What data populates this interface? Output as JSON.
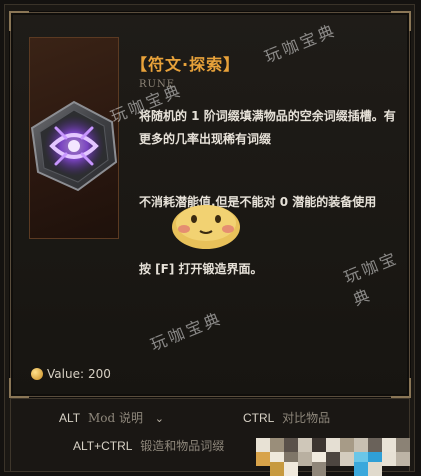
{
  "item": {
    "title": "【符文·探索】",
    "subtitle": "RUNE",
    "description_1": "将随机的 1 阶词缀填满物品的空余词缀插槽。有更多的几率出现稀有词缀",
    "description_2": "不消耗潜能值.但是不能对 0 潜能的装备使用",
    "description_3": "按 [F] 打开锻造界面。",
    "value_label": "Value:",
    "value": "200",
    "icon": "rune-purple-glyph-icon"
  },
  "hints": {
    "alt_key": "ALT",
    "alt_label": "Mod 说明",
    "ctrl_key": "CTRL",
    "ctrl_label": "对比物品",
    "altctrl_key": "ALT+CTRL",
    "altctrl_label": "锻造和物品词缀"
  },
  "watermark": {
    "text_1": "玩咖宝典",
    "text_2": "玩咖宝典",
    "text_3": "玩咖宝典",
    "text_4": "玩咖宝典"
  },
  "colors": {
    "title": "#e8a23a",
    "body_text": "#e6e1d8",
    "panel_border": "#5a4d3c",
    "rune_glow": "#9b4dff"
  }
}
